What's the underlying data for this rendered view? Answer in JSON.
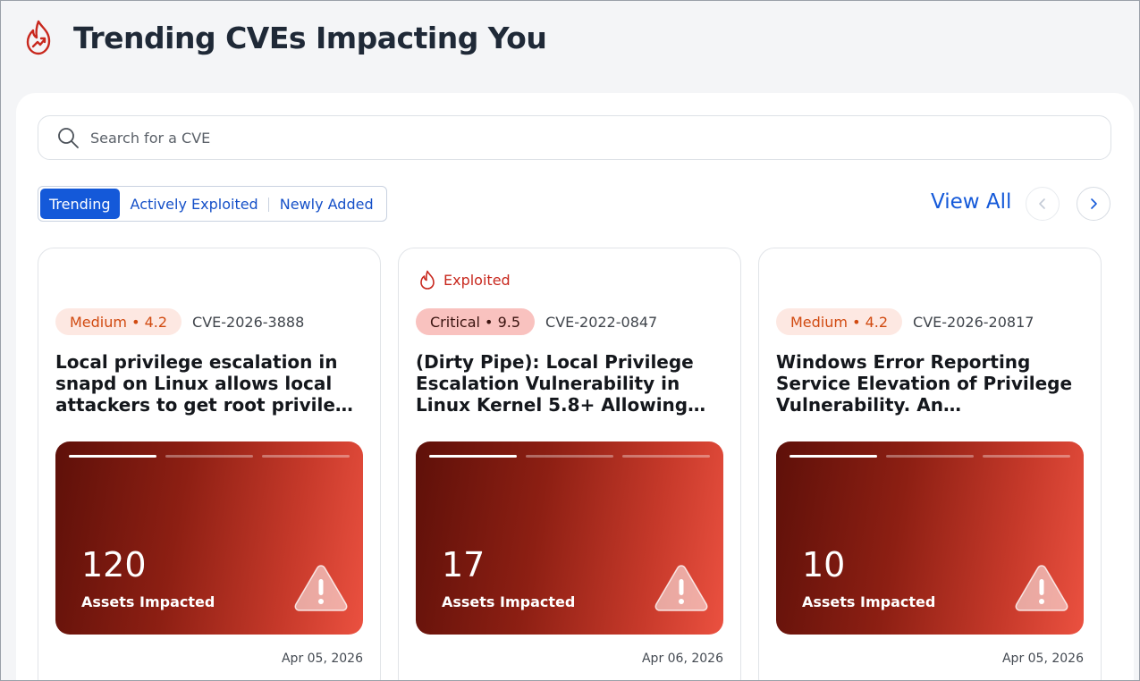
{
  "header": {
    "title": "Trending CVEs Impacting You",
    "icon": "fire-trend-icon"
  },
  "search": {
    "placeholder": "Search for a CVE",
    "value": ""
  },
  "tabs": [
    {
      "label": "Trending",
      "active": true
    },
    {
      "label": "Actively Exploited",
      "active": false
    },
    {
      "label": "Newly Added",
      "active": false
    }
  ],
  "view_all_label": "View All",
  "colors": {
    "accent": "#1459d9",
    "danger": "#c8281e",
    "medium_text": "#d14a10",
    "medium_bg": "#fde8e2",
    "critical_bg": "#f9c2bf"
  },
  "cards": [
    {
      "exploited_label": "",
      "severity": "Medium • 4.2",
      "severity_level": "medium",
      "cve_id": "CVE-2026-3888",
      "title": "Local privilege escalation in snapd on Linux allows local attackers to get root privilege by re-creating snap's private /tmp directory when systemd-tmpfiles is configured",
      "assets_count": "120",
      "assets_label": "Assets Impacted",
      "date": "Apr 05, 2026"
    },
    {
      "exploited_label": "Exploited",
      "severity": "Critical • 9.5",
      "severity_level": "critical",
      "cve_id": "CVE-2022-0847",
      "title": "(Dirty Pipe): Local Privilege Escalation Vulnerability in Linux Kernel 5.8+ Allowing Unprivileged Users to Overwrite Data in Read-Only Files",
      "assets_count": "17",
      "assets_label": "Assets Impacted",
      "date": "Apr 06, 2026"
    },
    {
      "exploited_label": "",
      "severity": "Medium • 4.2",
      "severity_level": "medium",
      "cve_id": "CVE-2026-20817",
      "title": "Windows Error Reporting Service Elevation of Privilege Vulnerability. An authenticated attacker could exploit this vulnerability to elevate privileges locally",
      "assets_count": "10",
      "assets_label": "Assets Impacted",
      "date": "Apr 05, 2026"
    }
  ]
}
